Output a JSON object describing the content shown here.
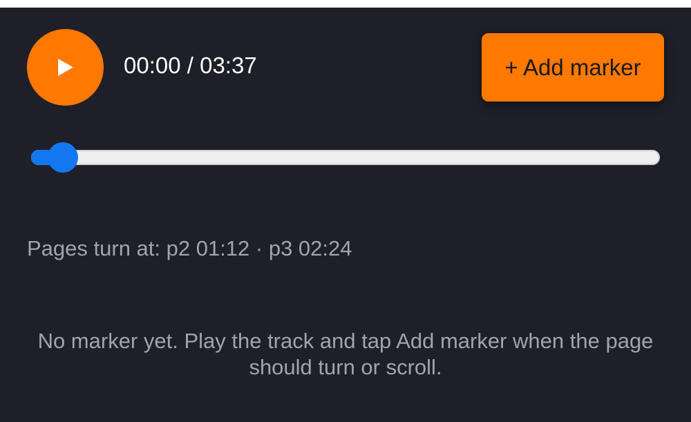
{
  "player": {
    "play_icon": "play-icon",
    "time_readout": "00:00 / 03:37",
    "add_marker_label": "+ Add marker",
    "progress_fraction": 0.05,
    "colors": {
      "accent": "#ff7800",
      "seek_fill": "#1378f0",
      "background": "#1f1f29",
      "muted_text": "#a3a3ad"
    }
  },
  "page_turns": {
    "text": "Pages turn at: p2 01:12 · p3 02:24"
  },
  "markers": {
    "empty_message": "No marker yet. Play the track and tap Add marker when the page should turn or scroll."
  }
}
